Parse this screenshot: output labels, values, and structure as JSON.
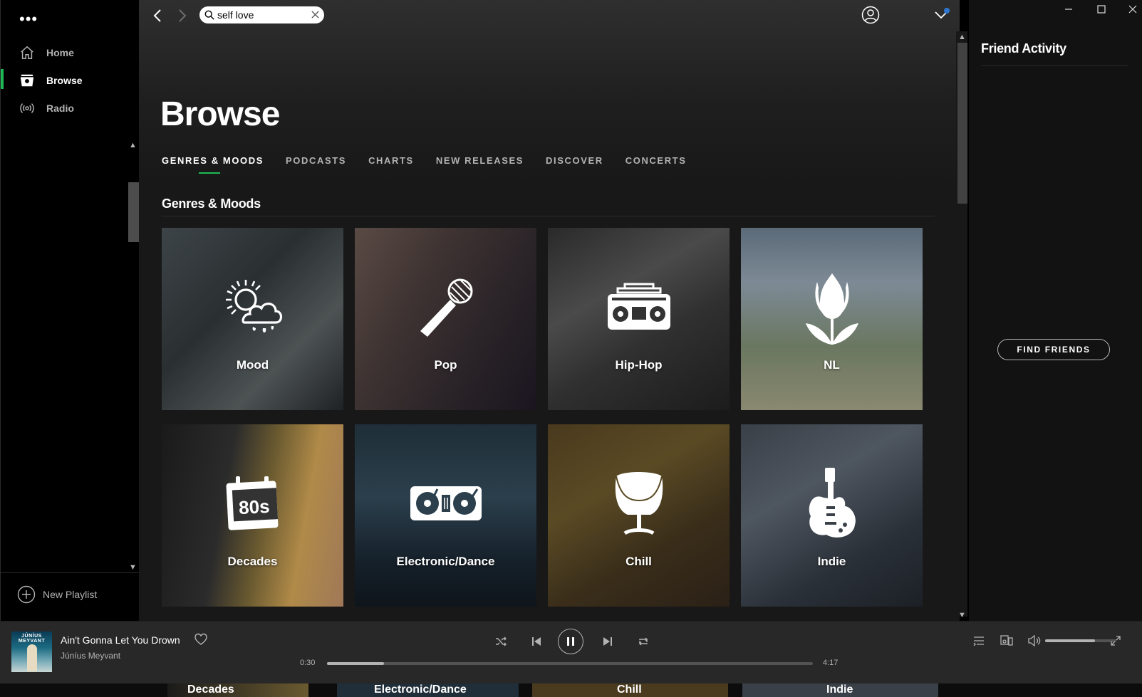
{
  "sidebar": {
    "menu_icon": "more-dots-icon",
    "items": [
      {
        "label": "Home",
        "icon": "home-icon",
        "active": false
      },
      {
        "label": "Browse",
        "icon": "browse-icon",
        "active": true
      },
      {
        "label": "Radio",
        "icon": "radio-icon",
        "active": false
      }
    ],
    "new_playlist_label": "New Playlist"
  },
  "topbar": {
    "search_value": "self love",
    "back_icon": "chevron-left-icon",
    "forward_icon": "chevron-right-icon",
    "user_icon": "user-icon",
    "dropdown_icon": "chevron-down-icon",
    "notification_color": "#2e77d0"
  },
  "browse": {
    "title": "Browse",
    "tabs": [
      "GENRES & MOODS",
      "PODCASTS",
      "CHARTS",
      "NEW RELEASES",
      "DISCOVER",
      "CONCERTS"
    ],
    "active_tab": "GENRES & MOODS",
    "section_title": "Genres & Moods",
    "tiles": [
      {
        "label": "Mood",
        "icon": "weather-icon"
      },
      {
        "label": "Pop",
        "icon": "microphone-icon"
      },
      {
        "label": "Hip-Hop",
        "icon": "boombox-icon"
      },
      {
        "label": "NL",
        "icon": "tulip-icon"
      },
      {
        "label": "Decades",
        "icon": "calendar-80s-icon"
      },
      {
        "label": "Electronic/Dance",
        "icon": "turntables-icon"
      },
      {
        "label": "Chill",
        "icon": "egg-chair-icon"
      },
      {
        "label": "Indie",
        "icon": "guitar-icon"
      }
    ],
    "badge_80s": "80s"
  },
  "friends": {
    "title": "Friend Activity",
    "find_label": "FIND FRIENDS"
  },
  "window_controls": [
    "minimize-icon",
    "maximize-icon",
    "close-icon"
  ],
  "player": {
    "track": "Ain't Gonna Let You Drown",
    "artist": "Júníus Meyvant",
    "album_band_text": "JÚNÍUS MEYVANT",
    "elapsed": "0:30",
    "duration": "4:17",
    "progress": 0.117,
    "volume": 0.7,
    "accent_color": "#1db954"
  },
  "peek_labels": [
    "Decades",
    "Electronic/Dance",
    "Chill",
    "Indie"
  ]
}
